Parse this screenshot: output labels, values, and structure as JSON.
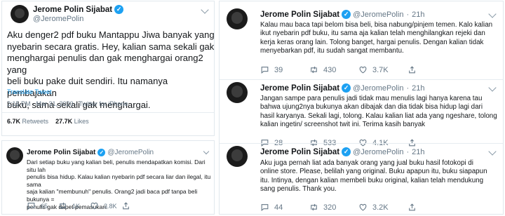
{
  "left_main": {
    "name": "Jerome Polin Sijabat",
    "handle": "@JeromePolin",
    "body": "Aku denger2 pdf buku Mantappu Jiwa banyak yang\nnyebarin secara gratis. Hey, kalian sama sekali gak\nmenghargai penulis dan gak menghargai orang2 yang\nbeli buku pake duit sendiri. Itu namanya pembajakan\nbuku, sama sekali gak menghargai.",
    "translate": "Translate Tweet",
    "meta": "2:15 PM · Mar 31, 2020 · Twitter for iPhone",
    "retweets_count": "6.7K",
    "retweets_label": "Retweets",
    "likes_count": "27.7K",
    "likes_label": "Likes"
  },
  "left_reply": {
    "name": "Jerome Polin Sijabat",
    "handle": "@JeromePolin",
    "body": "Dari setiap buku yang kalian beli, penulis mendapatkan komisi. Dari situ lah\npenulis bisa hidup. Kalau kalian nyebarin pdf secara liar dan ilegal, itu sama\nsaja kalian \"membunuh\" penulis. Orang2 jadi baca pdf tanpa beli bukunya =\npenulis gak dapet pemasukan.",
    "replies": "65",
    "retweets": "1K",
    "likes": "3.8K"
  },
  "right_tweets": [
    {
      "name": "Jerome Polin Sijabat",
      "handle": "@JeromePolin",
      "time": "21h",
      "body": "Kalau mau baca tapi belom bisa beli, bisa nabung/pinjem temen. Kalo kalian\nikut nyebarin pdf buku, itu sama aja kalian telah menghilangkan rejeki dan\nkerja keras orang lain. Tolong banget, hargai penulis. Dengan kalian tidak\nmenyebarkan pdf, itu sudah sangat membantu.",
      "replies": "39",
      "retweets": "430",
      "likes": "3.7K"
    },
    {
      "name": "Jerome Polin Sijabat",
      "handle": "@JeromePolin",
      "time": "21h",
      "body": "Jangan sampe para penulis jadi tidak mau menulis lagi hanya karena tau\nbahwa ujung2nya bukunya akan dibajak dan dia tidak bisa hidup lagi dari\nhasil karyanya. Sekali lagi, tolong. Kalau kalian liat ada yang ngeshare, tolong\nkalian ingetin/ screenshot twit ini. Terima kasih banyak",
      "replies": "28",
      "retweets": "533",
      "likes": "4.1K"
    },
    {
      "name": "Jerome Polin Sijabat",
      "handle": "@JeromePolin",
      "time": "21h",
      "body": "Aku juga pernah liat ada banyak orang yang jual buku hasil fotokopi di\nonline store. Please, belilah yang original. Buku apapun itu, buku siapapun\nitu. Intinya, dengan kalian membeli buku original, kalian telah mendukung\nsang penulis. Thank you.",
      "replies": "44",
      "retweets": "320",
      "likes": "3.2K"
    }
  ],
  "colors": {
    "verified": "#1da1f2",
    "text": "#14171a",
    "muted": "#657786",
    "link": "#1da1f2"
  },
  "icons": [
    "reply-icon",
    "retweet-icon",
    "like-icon",
    "share-icon",
    "verified-icon",
    "chevron-down-icon"
  ]
}
